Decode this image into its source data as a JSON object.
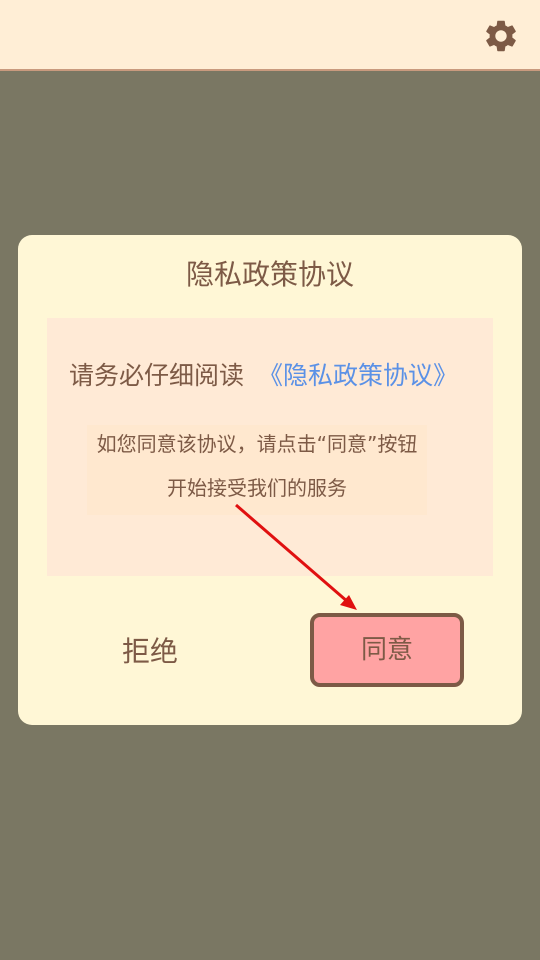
{
  "topbar": {
    "settings_icon": "gear-icon"
  },
  "dialog": {
    "title": "隐私政策协议",
    "read_prefix": "请务必仔细阅读",
    "policy_link": "《隐私政策协议》",
    "hint_line1": "如您同意该协议，请点击“同意”按钮",
    "hint_line2": "开始接受我们的服务",
    "reject_label": "拒绝",
    "agree_label": "同意"
  },
  "colors": {
    "overlay": "#7a7763",
    "topbar": "#ffeed6",
    "dialog_bg": "#fff7d6",
    "content_bg": "#ffead6",
    "text": "#7d5a46",
    "link": "#5b91e6",
    "agree_bg": "#ffa3a3",
    "arrow": "#e01010"
  }
}
